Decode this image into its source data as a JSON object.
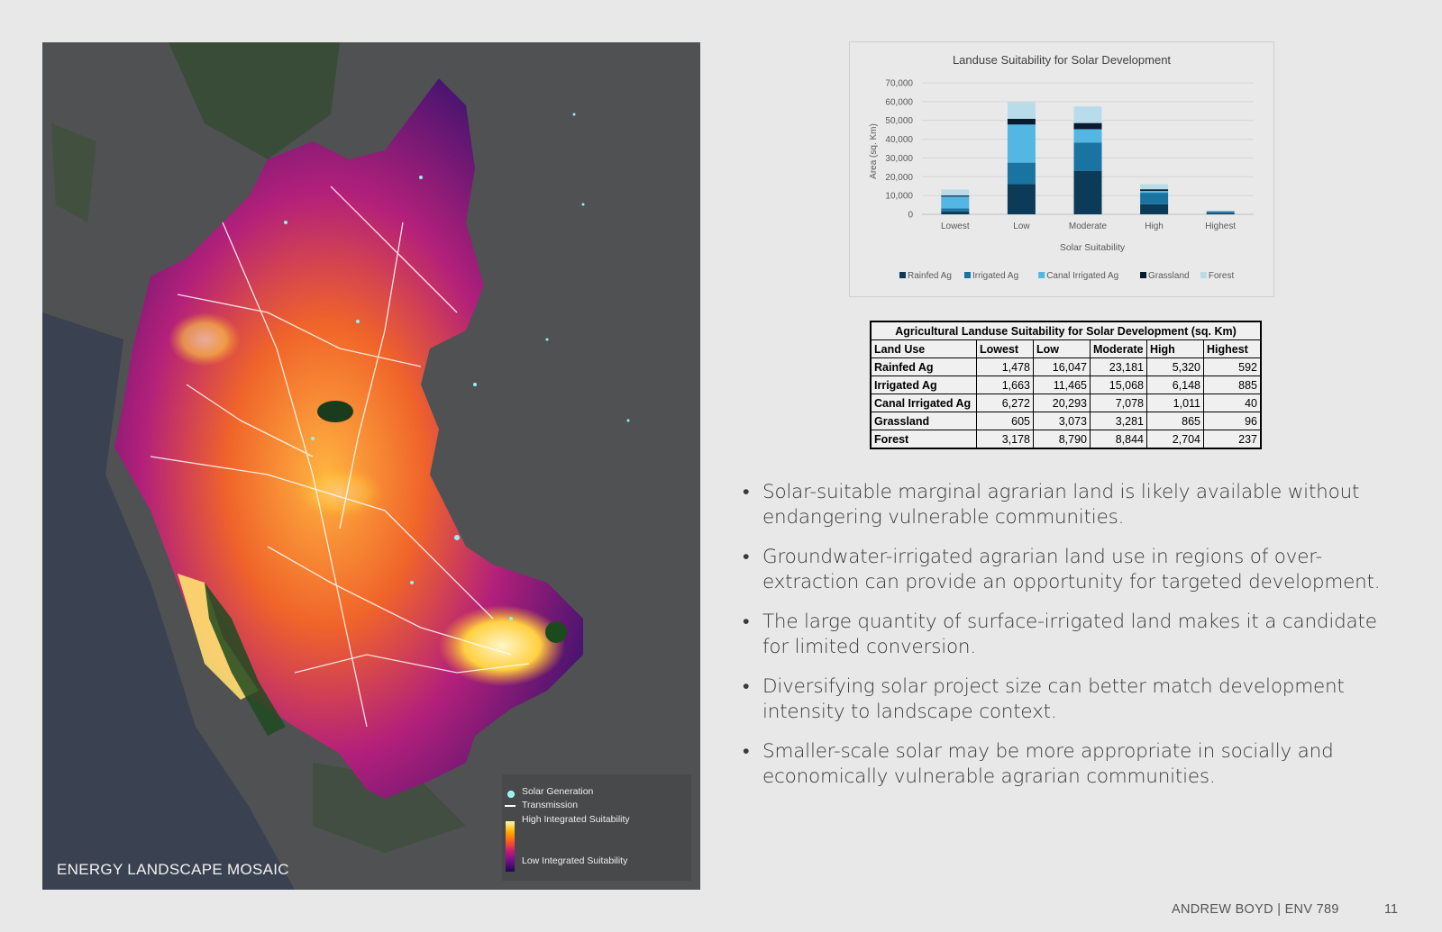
{
  "map": {
    "title": "ENERGY LANDSCAPE MOSAIC",
    "legend": {
      "solar": "Solar Generation",
      "transmission": "Transmission",
      "high": "High Integrated Suitability",
      "low": "Low Integrated Suitability"
    }
  },
  "chart_data": {
    "type": "bar",
    "stacked": true,
    "title": "Landuse Suitability for Solar Development",
    "xlabel": "Solar Suitability",
    "ylabel": "Area (sq. Km)",
    "ylim": [
      0,
      70000
    ],
    "yticks": [
      "0",
      "10,000",
      "20,000",
      "30,000",
      "40,000",
      "50,000",
      "60,000",
      "70,000"
    ],
    "categories": [
      "Lowest",
      "Low",
      "Moderate",
      "High",
      "Highest"
    ],
    "legend_position": "bottom",
    "series": [
      {
        "name": "Rainfed Ag",
        "color": "#0b3b58",
        "values": [
          1478,
          16047,
          23181,
          5320,
          592
        ]
      },
      {
        "name": "Irrigated Ag",
        "color": "#1a74a2",
        "values": [
          1663,
          11465,
          15068,
          6148,
          885
        ]
      },
      {
        "name": "Canal Irrigated Ag",
        "color": "#54b6e3",
        "values": [
          6272,
          20293,
          7078,
          1011,
          40
        ]
      },
      {
        "name": "Grassland",
        "color": "#071c2e",
        "values": [
          605,
          3073,
          3281,
          865,
          96
        ]
      },
      {
        "name": "Forest",
        "color": "#b9dcea",
        "values": [
          3178,
          8790,
          8844,
          2704,
          237
        ]
      }
    ]
  },
  "table": {
    "title": "Agricultural Landuse Suitability for Solar Development (sq. Km)",
    "headers": [
      "Land Use",
      "Lowest",
      "Low",
      "Moderate",
      "High",
      "Highest"
    ],
    "rows": [
      {
        "label": "Rainfed Ag",
        "c1": "1,478",
        "c2": "16,047",
        "c3": "23,181",
        "c4": "5,320",
        "c5": "592"
      },
      {
        "label": "Irrigated Ag",
        "c1": "1,663",
        "c2": "11,465",
        "c3": "15,068",
        "c4": "6,148",
        "c5": "885"
      },
      {
        "label": "Canal Irrigated Ag",
        "c1": "6,272",
        "c2": "20,293",
        "c3": "7,078",
        "c4": "1,011",
        "c5": "40"
      },
      {
        "label": "Grassland",
        "c1": "605",
        "c2": "3,073",
        "c3": "3,281",
        "c4": "865",
        "c5": "96"
      },
      {
        "label": "Forest",
        "c1": "3,178",
        "c2": "8,790",
        "c3": "8,844",
        "c4": "2,704",
        "c5": "237"
      }
    ]
  },
  "bullets": [
    "Solar-suitable marginal agrarian land is likely available without endangering vulnerable communities.",
    "Groundwater-irrigated agrarian land use in regions of over-extraction can provide an opportunity for targeted development.",
    "The large quantity of surface-irrigated land makes it a candidate for limited conversion.",
    "Diversifying solar project size can better match development intensity to landscape context.",
    "Smaller-scale solar may be more appropriate in socially and economically vulnerable agrarian communities."
  ],
  "footer": {
    "author": "ANDREW BOYD | ENV 789",
    "page": "11"
  }
}
